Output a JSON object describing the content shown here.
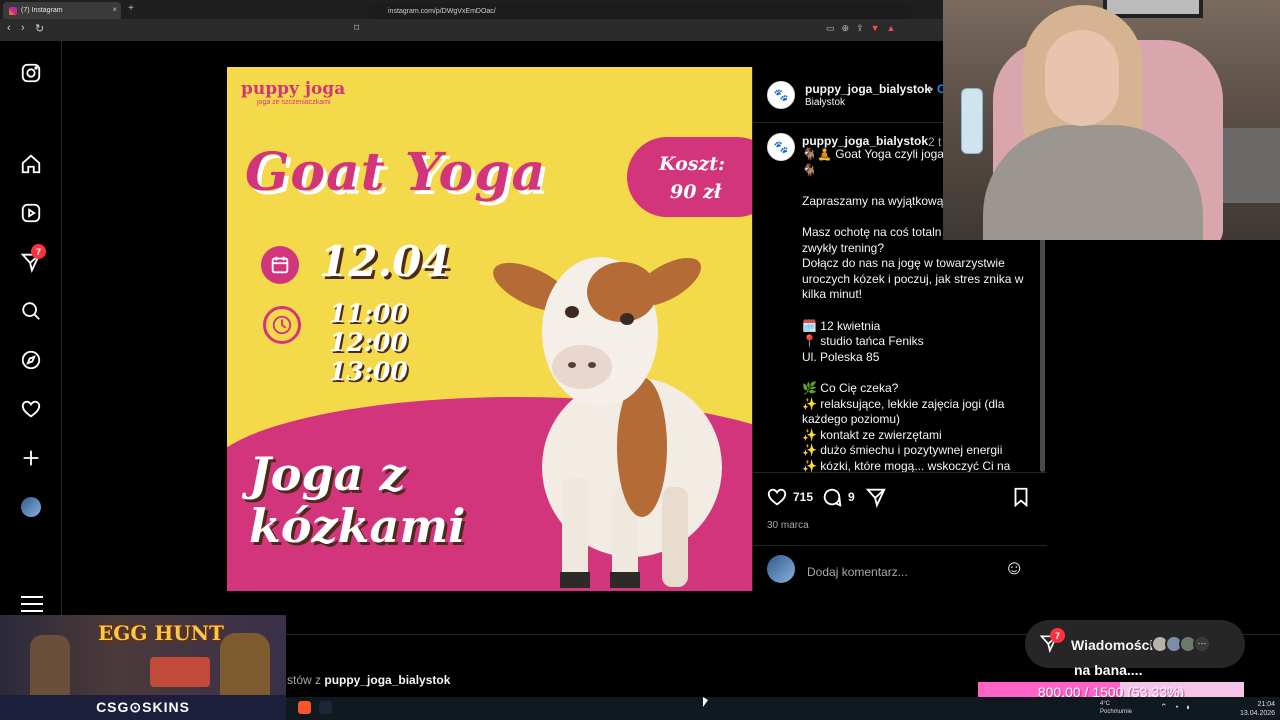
{
  "browser": {
    "tab_title": "(7) Instagram",
    "tab_close": "×",
    "new_tab": "+",
    "url": "instagram.com/p/DWgVxEmDOac/"
  },
  "rail": {
    "notifications_badge": "7",
    "menu_label": "Więcej"
  },
  "post_image": {
    "brand": "puppy joga",
    "brand_sub": "joga ze szczeniaczkami",
    "title": "Goat Yoga",
    "price_label": "Koszt:",
    "price_value": "90 zł",
    "date": "12.04",
    "times": [
      "11:00",
      "12:00",
      "13:00"
    ],
    "bottom_line1": "Joga z",
    "bottom_line2": "kózkami"
  },
  "side": {
    "header_username": "puppy_joga_bialystok",
    "header_dot": "•",
    "header_follow": "O",
    "header_location": "Białystok",
    "caption_username": "puppy_joga_bialystok",
    "caption_time": "2 t",
    "caption_text": "🐐🧘 Goat Yoga czyli joga\n🐐\n\nZapraszamy na wyjątkową\n\nMasz ochotę na coś totaln\nzwykły trening?\nDołącz do nas na jogę w towarzystwie\nuroczych kózek i poczuj, jak stres znika w\nkilka minut!\n\n🗓️ 12 kwietnia\n📍 studio tańca Feniks\nUl. Poleska 85\n\n🌿 Co Cię czeka?\n✨ relaksujące, lekkie zajęcia jogi (dla\nkażdego poziomu)\n✨ kontakt ze zwierzętami\n✨ dużo śmiechu i pozytywnej energii\n✨ kózki, które mogą... wskoczyć Ci na",
    "likes": "715",
    "comments": "9",
    "date": "30 marca",
    "comment_placeholder": "Dodaj komentarz...",
    "emoji_icon": "☺"
  },
  "more_from": {
    "prefix": "stów z",
    "username": "puppy_joga_bialystok"
  },
  "overlays": {
    "egg_hunt": "EGG HUNT",
    "csg": "CSG⊙SKINS",
    "messages_label": "Wiadomości",
    "messages_badge": "7",
    "messages_more": "···",
    "ban_text": "na bana....",
    "goal_text": "800.00 / 1500 (53.33%)",
    "goal_fraction": 0.5333
  },
  "taskbar": {
    "weather_line1": "4°C",
    "weather_line2": "Pochmurnie",
    "time": "21:04",
    "date": "13.04.2026"
  },
  "colors": {
    "brand_pink": "#d2357c",
    "yellow": "#f4d94a",
    "ig_bg": "#000000",
    "badge_red": "#ff3040"
  }
}
